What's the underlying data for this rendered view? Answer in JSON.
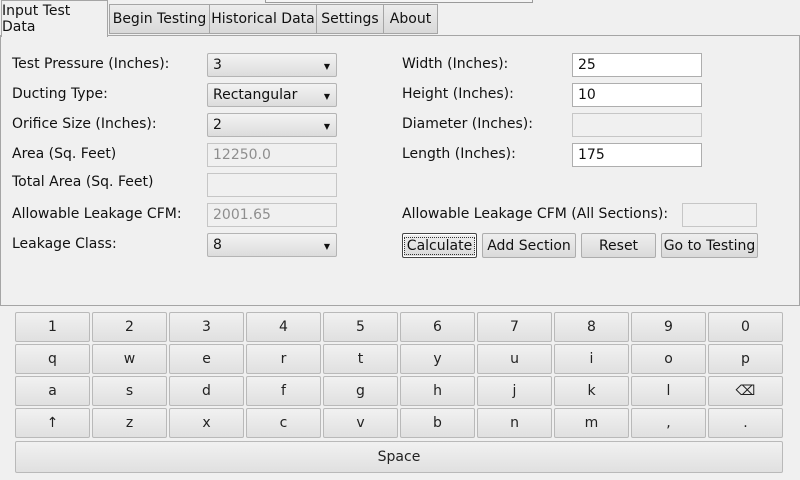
{
  "tabs": [
    {
      "label": "Input Test Data",
      "active": true
    },
    {
      "label": "Begin Testing",
      "active": false
    },
    {
      "label": "Historical Data",
      "active": false
    },
    {
      "label": "Settings",
      "active": false
    },
    {
      "label": "About",
      "active": false
    }
  ],
  "form": {
    "test_pressure_label": "Test Pressure (Inches):",
    "test_pressure_value": "3",
    "ducting_type_label": "Ducting Type:",
    "ducting_type_value": "Rectangular",
    "orifice_size_label": "Orifice Size (Inches):",
    "orifice_size_value": "2",
    "area_label": "Area (Sq. Feet)",
    "area_value": "12250.0",
    "total_area_label": "Total Area (Sq. Feet)",
    "total_area_value": "",
    "allowable_leakage_label": "Allowable Leakage CFM:",
    "allowable_leakage_value": "2001.65",
    "leakage_class_label": "Leakage Class:",
    "leakage_class_value": "8",
    "width_label": "Width (Inches):",
    "width_value": "25",
    "height_label": "Height (Inches):",
    "height_value": "10",
    "diameter_label": "Diameter (Inches):",
    "diameter_value": "",
    "length_label": "Length (Inches):",
    "length_value": "175",
    "allowable_all_label": "Allowable Leakage CFM (All Sections):",
    "allowable_all_value": ""
  },
  "buttons": {
    "calculate": "Calculate",
    "add_section": "Add Section",
    "reset": "Reset",
    "go_to_testing": "Go to Testing"
  },
  "keyboard": {
    "row1": [
      "1",
      "2",
      "3",
      "4",
      "5",
      "6",
      "7",
      "8",
      "9",
      "0"
    ],
    "row2": [
      "q",
      "w",
      "e",
      "r",
      "t",
      "y",
      "u",
      "i",
      "o",
      "p"
    ],
    "row3": [
      "a",
      "s",
      "d",
      "f",
      "g",
      "h",
      "j",
      "k",
      "l",
      "⌫"
    ],
    "row4": [
      "↑",
      "z",
      "x",
      "c",
      "v",
      "b",
      "n",
      "m",
      ",",
      "."
    ],
    "space": "Space"
  },
  "icons": {
    "dropdown": "chevron-down-icon",
    "backspace": "backspace-icon",
    "shift": "shift-icon"
  }
}
